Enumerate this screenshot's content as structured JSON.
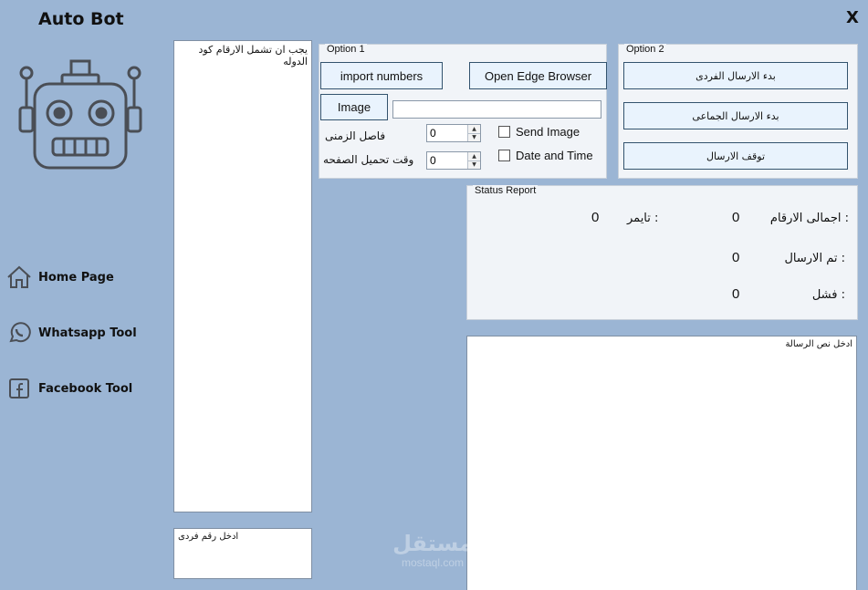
{
  "app": {
    "title": "Auto Bot",
    "close_label": "X"
  },
  "sidebar": {
    "items": [
      {
        "label": "Home Page",
        "icon": "home-icon"
      },
      {
        "label": "Whatsapp Tool",
        "icon": "whatsapp-icon"
      },
      {
        "label": "Facebook Tool",
        "icon": "facebook-icon"
      }
    ]
  },
  "numbers_box": {
    "placeholder": "يجب ان تشمل الارقام كود الدوله"
  },
  "single_number": {
    "placeholder": "ادخل رقم فردى"
  },
  "option1": {
    "legend": "Option 1",
    "import_label": "import numbers",
    "edge_label": "Open Edge Browser",
    "image_label": "Image",
    "image_path": "",
    "interval_label": "فاصل الزمنى",
    "interval_value": "0",
    "page_load_label": "وقت تحميل الصفحه",
    "page_load_value": "0",
    "send_image_label": "Send Image",
    "date_time_label": "Date and Time"
  },
  "option2": {
    "legend": "Option 2",
    "single_send_label": "بدء الارسال الفردى",
    "bulk_send_label": "بدء الارسال الجماعى",
    "stop_label": "توقف الارسال"
  },
  "status": {
    "legend": "Status Report",
    "total_label": "اجمالى الارقام :",
    "total_value": "0",
    "timer_label": "تايمر :",
    "timer_value": "0",
    "sent_label": "تم الارسال :",
    "sent_value": "0",
    "failed_label": "فشل :",
    "failed_value": "0"
  },
  "message_box": {
    "placeholder": "ادخل نص الرسالة"
  },
  "watermark": {
    "arabic": "مستقل",
    "latin": "mostaql.com"
  },
  "colors": {
    "background": "#9bb5d4",
    "button_bg": "#e9f3fd",
    "button_border": "#33536e",
    "logo_stroke": "#4a4e55"
  }
}
